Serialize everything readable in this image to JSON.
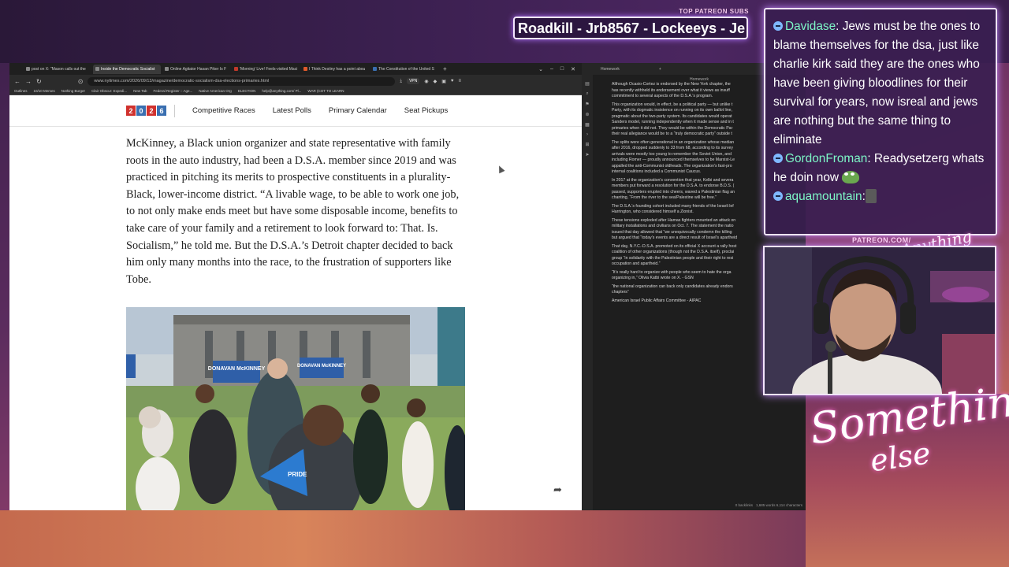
{
  "stream": {
    "patreon_subs_title": "TOP PATREON SUBS",
    "patreon_subs_ticker": "Roadkill - Jrb8567 - Lockeeys - Je",
    "patreon_url": "PATREON.COM/",
    "brand_small": "Anything Else",
    "brand_big_line1": "Something",
    "brand_big_line2": "else"
  },
  "chat": {
    "messages": [
      {
        "user": "Davidase",
        "text": ": Jews must be the ones to blame themselves for the dsa, just like charlie kirk said they are the ones who have been giving bloodlines for their survival for years, now isreal and jews are nothing but the same thing to eliminate"
      },
      {
        "user": "GordonFroman",
        "text": ": Readysetzerg whats he doin now"
      },
      {
        "user": "aquamountain",
        "text": ":"
      }
    ]
  },
  "browser": {
    "tabs": [
      {
        "label": "post on X: \"Mason calls out the"
      },
      {
        "label": "Inside the Democratic Socialist",
        "active": true
      },
      {
        "label": "Online Agitator Hasan Piker Is F"
      },
      {
        "label": "'Morning' Live! Feels-visited Maci"
      },
      {
        "label": "I Think Destiny has a point abou"
      },
      {
        "label": "The Constitution of the United S"
      }
    ],
    "url": "www.nytimes.com/2026/09/13/magazine/democratic-socialism-dsa-elections-primaries.html",
    "vpn": "VPN",
    "bookmarks": [
      "Outlines",
      "10/10 Memes",
      "Nothing Burger",
      "Clair Obscur: Expedi...",
      "New Tab",
      "Federal Register :: Age...",
      "Native American Org",
      "ELECTION",
      "help@anything.com/ Pl...",
      "WAR (COT TO LEARN"
    ]
  },
  "nyt": {
    "nav": [
      "Competitive Races",
      "Latest Polls",
      "Primary Calendar",
      "Seat Pickups"
    ],
    "logo_digits": [
      "2",
      "0",
      "2",
      "6"
    ],
    "paragraph": "McKinney, a Black union organizer and state representative with family roots in the auto industry, had been a D.S.A. member since 2019 and was practiced in pitching its merits to prospective constituents in a plurality-Black, lower-income district. “A livable wage, to be able to work one job, to not only make ends meet but have some disposable income, benefits to take care of your family and a retirement to look forward to: That. Is. Socialism,” he told me. But the D.S.A.’s Detroit chapter decided to back him only many months into the race, to the frustration of supporters like Tobe.",
    "sign_text_1": "DONAVAN McKINNEY",
    "sign_text_2": "DONAVAN McKINNEY",
    "megaphone_text": "PRIDE"
  },
  "obsidian": {
    "tab_label": "Homework",
    "note_title": "Homework",
    "lines": [
      "Although Ocasio-Cortez is endorsed by the New York chapter, the",
      "has recently withheld its endorsement over what it views as insuff",
      "commitment to several aspects of the D.S.A.'s program.",
      "",
      "This organization would, in effect, be a political party — but unlike t",
      "Party, with its dogmatic insistence on running on its own ballot line,",
      "pragmatic about the two-party system. Its candidates would operat",
      "Sanders model, running independently when it made sense and in t",
      "primaries when it did not. They would be within the Democratic Par",
      "their real allegiance would be to a “truly democratic party” outside t",
      "",
      "The splits were often generational in an organization whose median",
      "after 2016, dropped suddenly to 33 from 68, according to its survey",
      "arrivals were mostly too young to remember the Soviet Union, and",
      "including Romer — proudly announced themselves to be Marxist-Le",
      "appalled the anti-Communist oldheads. The organization's fast-pro",
      "internal coalitions included a Communist Caucus.",
      "",
      "In 2017 at the organization's convention that year, Kelbi and severa",
      "members put forward a resolution for the D.S.A. to endorse B.D.S. (",
      "passed, supporters erupted into cheers, waved a Palestinian flag an",
      "chanting, “From the river to the sea/Palestine will be free.”",
      "",
      "The D.S.A.'s founding cohort included many friends of the Israeli lef",
      "Harrington, who considered himself a Zionist.",
      "",
      "These tensions exploded after Hamas fighters mounted an attack on",
      "military installations and civilians on Oct. 7. The statement the natio",
      "issued that day allowed that “we unequivocally condemn the killing",
      "but argued that “today's events are a direct result of Israel's apartheid",
      "",
      "That day, N.Y.C.-D.S.A. promoted on its official X account a rally host",
      "coalition of other organizations (though not the D.S.A. itself), proclai",
      "group “in solidarity with the Palestinian people and their right to resi",
      "occupation and apartheid.”",
      "",
      "“It's really hard to organize with people who seem to hate the orga",
      "organizing in,” Olivia Katbi wrote on X. - GSN",
      "",
      "“the national organization can back only candidates already endors",
      "chapters”",
      "",
      "American Israel Public Affairs Committee - AIPAC"
    ],
    "status_backlinks": "0 backlinks",
    "status_words": "1,685 words  6,114 characters"
  },
  "colors": {
    "nyt_red": "#d0312d",
    "nyt_blue": "#3a6fb0",
    "chat_name": "#7df7c7",
    "obsidian_link": "#c98fff"
  }
}
